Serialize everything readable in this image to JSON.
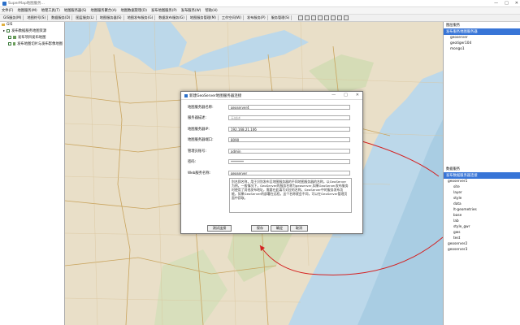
{
  "app": {
    "title": "SuperMap地图服务..."
  },
  "window_controls": [
    "—",
    "□",
    "✕"
  ],
  "menus": [
    "文件(F)",
    "地图服务(M)",
    "地理工具(T)",
    "地图服务器(S)",
    "地图服务聚合(A)",
    "地图数据管理(D)",
    "发布地图服务(P)",
    "发布服务(W)",
    "帮助(H)"
  ],
  "toolbar": [
    "GIS服务(M)",
    "地图符号(S)",
    "数据服务(D)",
    "图层服务(L)",
    "地图服务器(S)",
    "地图发布服务(G)",
    "数据发布服务(G)",
    "地图服务管理(M)",
    "工作空间(W)",
    "发布服务(P)",
    "服务管理(S)"
  ],
  "left_panel": {
    "root": "GIS",
    "items": [
      "发布数据服务地图资源",
      "发布项目发布地图",
      "发布地图切片与发布影像地图"
    ]
  },
  "right_panel": {
    "top_header": "图层服务",
    "top_selected": "发布服务地图服务器",
    "top_items": [
      "geoserver",
      "geotiger104",
      "mongo1"
    ],
    "bottom_header": "数据服务",
    "bottom_selected": "发布数据服务器连接",
    "bottom_items": [
      "geoserver1",
      "site",
      "layer",
      "style",
      "data",
      "lt-geometries",
      "base",
      "lab",
      "style_gwr",
      "gws",
      "test"
    ],
    "bottom_items2": [
      "geoserver2",
      "geoserver3"
    ]
  },
  "dialog": {
    "title": "新建GeoServer地图服务器连接",
    "fields": [
      {
        "label": "地图服务器名称:",
        "value": "geoserver4"
      },
      {
        "label": "服务器描述:",
        "value": "无描述"
      },
      {
        "label": "地图服务器IP:",
        "value": "192.168.21.106"
      },
      {
        "label": "地图服务器端口:",
        "value": "8090"
      },
      {
        "label": "管理员账号:",
        "value": "admin"
      },
      {
        "label": "密码:",
        "value": "********"
      },
      {
        "label": "Web服务名称:",
        "value": "geoserver"
      }
    ],
    "note": "别名即名称，用于识别发布至地图服务器的不同地图服务器的名称。以GeoServer为例，一般情况下，GeoServer的服务名称为geoserver,如果GeoServer发布服务时使用了其他发布地址，需要在此填写对应的名称。GeoServer中的服务发布功能，如果GeoServer的部署在远程，这个名称就会不同，可以在GeoServer管理页面中获取。",
    "buttons": [
      "测试连接",
      "保存",
      "确定",
      "取消"
    ]
  },
  "colors": {
    "map_land": "#e9dfc8",
    "map_water": "#bcd8ea",
    "selection": "#3875d7",
    "annotation_arrow": "#d42020"
  }
}
